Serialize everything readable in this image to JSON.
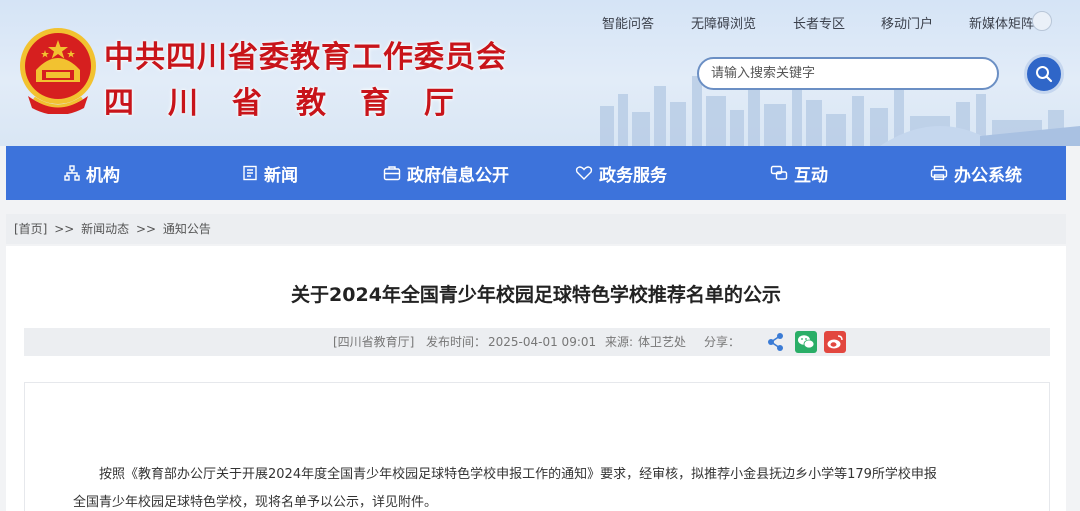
{
  "header": {
    "title_line1": "中共四川省委教育工作委员会",
    "title_line2": "四川省教育厅",
    "top_links": [
      "智能问答",
      "无障碍浏览",
      "长者专区",
      "移动门户",
      "新媒体矩阵"
    ],
    "search": {
      "placeholder": "请输入搜索关键字"
    }
  },
  "nav": {
    "items": [
      {
        "label": "机构",
        "icon": "org-icon"
      },
      {
        "label": "新闻",
        "icon": "news-icon"
      },
      {
        "label": "政府信息公开",
        "icon": "info-open-icon"
      },
      {
        "label": "政务服务",
        "icon": "service-icon"
      },
      {
        "label": "互动",
        "icon": "interact-icon"
      },
      {
        "label": "办公系统",
        "icon": "office-icon"
      }
    ]
  },
  "breadcrumb": {
    "home": "[首页]",
    "sep": ">>",
    "items": [
      "新闻动态",
      "通知公告"
    ]
  },
  "article": {
    "title": "关于2024年全国青少年校园足球特色学校推荐名单的公示",
    "meta": {
      "publisher": "[四川省教育厅]",
      "date_label": "发布时间：",
      "date": "2025-04-01 09:01",
      "source_label": "来源:",
      "source": "体卫艺处",
      "share_label": "分享："
    },
    "share_icons": [
      "share-icon",
      "wechat-icon",
      "weibo-icon"
    ],
    "paragraph_line1": "按照《教育部办公厅关于开展2024年度全国青少年校园足球特色学校申报工作的通知》要求，经审核，拟推荐小金县抚边乡小学等179所学校申报",
    "paragraph_line2": "全国青少年校园足球特色学校，现将名单予以公示，详见附件。"
  },
  "colors": {
    "nav_bg": "#3d73db",
    "title_red": "#c8141a",
    "search_button": "#2f66c8"
  }
}
